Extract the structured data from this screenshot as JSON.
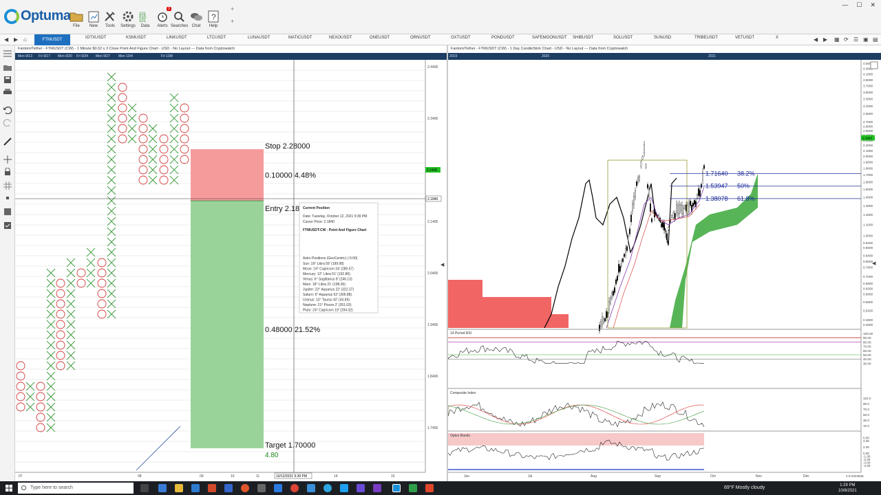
{
  "ribbon": {
    "logo_text": "Optuma",
    "buttons": [
      "File",
      "New",
      "Tools",
      "Settings",
      "Data",
      "Alerts",
      "Searches",
      "Chat",
      "Help"
    ],
    "alerts_badge": "3"
  },
  "tabs": {
    "active": "FTMUSDT",
    "items": [
      "IOTXUSDT",
      "KSMUSDT",
      "LINKUSDT",
      "LTCUSDT",
      "LUNAUSDT",
      "MATICUSDT",
      "NEXOUSDT",
      "ONEUSDT",
      "ORNUSDT",
      "OXTUSDT",
      "PONDUSDT",
      "SAFEMOONUSDT",
      "SHIBUSDT",
      "SOLUSDT",
      "SUNUSD",
      "TRIBEUSDT",
      "VETUSDT",
      "X"
    ]
  },
  "left_chart": {
    "header": "Fantom/Tether - FTMUSDT (CW) - 1 Minute $0.02 x 3 Close Point And Figure Chart - USD - No Layout --- Data from Cryptowatch",
    "time_labels": [
      "Mon 9/13",
      "Fri 9/17",
      "Mon 9/20",
      "Fri 9/24",
      "Mon 9/27",
      "Mon 10/4",
      "Fri 10/8"
    ],
    "price_axis": [
      "2.4400",
      "2.3400",
      "2.2400",
      "2.1840",
      "2.1400",
      "2.0400",
      "1.9400",
      "1.8400",
      "1.7400"
    ],
    "current_price": "2.2400",
    "crosshair_price": "2.1840",
    "date_axis": [
      "07",
      "08",
      "09",
      "10",
      "11",
      "14",
      "15"
    ],
    "crosshair_date": "10/12/2021 9:39 PM",
    "position": {
      "stop_label": "Stop",
      "stop_value": "2.28000",
      "risk_value": "0.10000",
      "risk_pct": "4.48%",
      "entry_label": "Entry",
      "entry_value": "2.18000",
      "reward_value": "0.48000",
      "reward_pct": "21.52%",
      "target_label": "Target",
      "target_value": "1.70000",
      "ratio": "4.80"
    },
    "tooltip": {
      "title": "Current Position",
      "date": "Date: Tuesday, October 12, 2021 9:39 PM",
      "cursor": "Cursor Price: 2.1840",
      "instrument": "FTMUSDT:CW - Point And Figure Chart",
      "astro_header": "Astro Positions (GeoCentric) (-5:00)",
      "astro": [
        "Sun: 19° Libra 59' (199.98)",
        "Moon: 19° Capricorn 34' (289.57)",
        "Mercury: 12° Libra 51' (192.86)",
        "Venus: 6° Sagittarius 8' (246.13)",
        "Mars: 18° Libra 21' (198.36)",
        "Jupiter: 22° Aquarius 22' (322.37)",
        "Saturn: 6° Aquarius 53' (306.88)",
        "Uranus: 13° Taurus 42' (43.69)",
        "Neptune: 21° Pisces 2' (351.03)",
        "Pluto: 24° Capricorn 19' (294.32)"
      ]
    }
  },
  "right_chart": {
    "header": "Fantom/Tether - FTMUSDT (CW) - 1 Day CandleStick Chart - USD - No Layout --- Data from Cryptowatch",
    "years": [
      "2019",
      "2020",
      "2021"
    ],
    "price_axis": [
      "4.5000",
      "4.3000",
      "4.1000",
      "3.9000",
      "3.7000",
      "3.5000",
      "3.3000",
      "3.1000",
      "2.9000",
      "2.7000",
      "2.6000",
      "2.5000",
      "2.4000",
      "2.3000",
      "2.2000",
      "2.1000",
      "2.0000",
      "1.9000",
      "1.8000",
      "1.7000",
      "1.6000",
      "1.5000",
      "1.4000",
      "1.3000",
      "1.2000",
      "1.1000",
      "1.0000",
      "0.9400",
      "0.9000",
      "0.8400",
      "0.8000",
      "0.7600",
      "0.7000",
      "0.6600",
      "0.6300",
      "0.6000",
      "0.5600",
      "0.5200",
      "0.4800",
      "0.4600"
    ],
    "current_price": "2.3463",
    "fib": [
      {
        "price": "1.71640",
        "pct": "38.2%"
      },
      {
        "price": "1.53947",
        "pct": "50%"
      },
      {
        "price": "1.38078",
        "pct": "61.8%"
      }
    ],
    "rsi_title": "14 Period RSI",
    "rsi_axis": [
      "100.00",
      "90.00",
      "80.00",
      "70.00",
      "60.00",
      "50.00",
      "40.00",
      "30.00"
    ],
    "composite_title": "Composite Index",
    "composite_axis": [
      "110.0",
      "90.0",
      "70.0",
      "50.0",
      "30.0",
      "10.0"
    ],
    "optex_title": "Optex Bands",
    "optex_axis": [
      "5.00",
      "4.00",
      "2.00",
      "0.00",
      "-1.00",
      "-2.00",
      "-3.00",
      "-4.00"
    ],
    "months": [
      "Jun",
      "Jul",
      "Aug",
      "Sep",
      "Oct",
      "Nov",
      "Dec"
    ],
    "corner_value": "2.0.0323536"
  },
  "taskbar": {
    "search_placeholder": "Type here to search",
    "weather": "69°F  Mostly cloudy",
    "time": "1:29 PM",
    "date": "10/8/2021"
  },
  "colors": {
    "stop_zone": "#f48a8a",
    "target_zone": "#8fce8f",
    "header_bar": "#1d3d63",
    "accent_blue": "#1f6fc0",
    "x_mark": "#3a9a3a",
    "o_mark": "#d33a3a"
  }
}
